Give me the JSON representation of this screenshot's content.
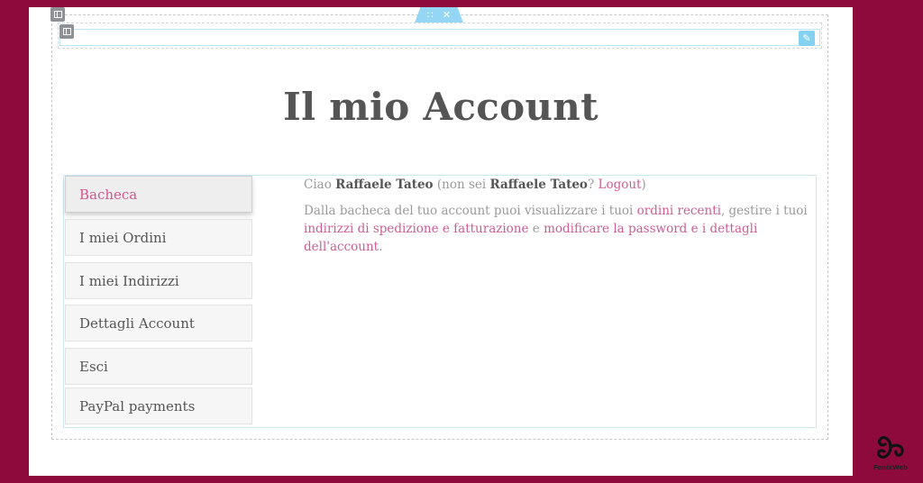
{
  "editor": {
    "handle_icons": {
      "drag": "drag-dots-icon",
      "close": "close-icon",
      "edit": "pencil-icon",
      "grid": "column-grid-icon"
    },
    "handle_drag": "∷",
    "handle_close": "✕",
    "edit_glyph": "✎"
  },
  "page": {
    "title": "Il mio Account"
  },
  "account_nav": {
    "items": [
      {
        "label": "Bacheca",
        "active": true
      },
      {
        "label": "I miei Ordini"
      },
      {
        "label": "I miei Indirizzi"
      },
      {
        "label": "Dettagli Account"
      },
      {
        "label": "Esci"
      },
      {
        "label": "PayPal payments"
      }
    ]
  },
  "dashboard": {
    "greeting": {
      "hello": "Ciao",
      "user": "Raffaele Tateo",
      "not_you_prefix": "(non sei",
      "not_you_user": "Raffaele Tateo",
      "question": "?",
      "logout": "Logout",
      "close_paren": ")"
    },
    "description": {
      "part1": "Dalla bacheca del tuo account puoi visualizzare i tuoi",
      "link_orders": "ordini recenti",
      "part2": ", gestire i tuoi",
      "link_addresses": "indirizzi di spedizione e fatturazione",
      "part3": "e",
      "link_password": "modificare la password e i dettagli dell'account",
      "part4": "."
    }
  },
  "branding": {
    "logo_text": "FenixWeb",
    "logo_icon": "triskelion-icon"
  },
  "colors": {
    "background": "#8e0a3c",
    "accent_pink": "#cc5e92",
    "editor_blue": "#95d6f4"
  }
}
